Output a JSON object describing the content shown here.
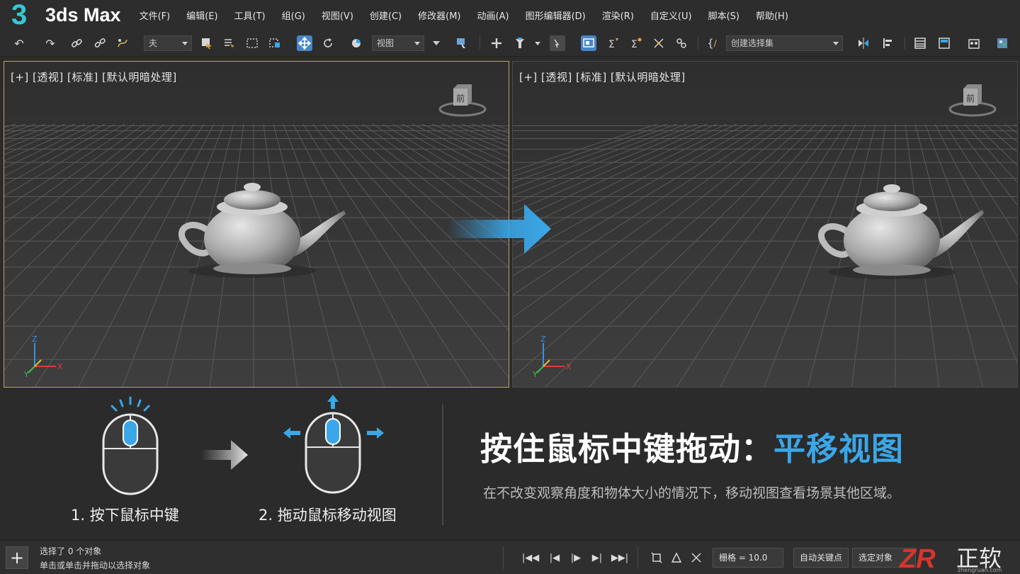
{
  "app": {
    "logo_number": "3",
    "name": "3ds Max"
  },
  "menu": [
    "文件(F)",
    "编辑(E)",
    "工具(T)",
    "组(G)",
    "视图(V)",
    "创建(C)",
    "修改器(M)",
    "动画(A)",
    "图形编辑器(D)",
    "渲染(R)",
    "自定义(U)",
    "脚本(S)",
    "帮助(H)"
  ],
  "toolbar": {
    "filter_dropdown": "夫",
    "reference_dropdown": "视图",
    "selection_set_dropdown": "创建选择集"
  },
  "viewports": {
    "left": {
      "label": "[+] [透视] [标准] [默认明暗处理]",
      "cube_face": "前"
    },
    "right": {
      "label": "[+] [透视] [标准] [默认明暗处理]",
      "cube_face": "前"
    },
    "axis": {
      "x": "X",
      "y": "Y",
      "z": "Z"
    }
  },
  "tutorial": {
    "step1": "1. 按下鼠标中键",
    "step2": "2. 拖动鼠标移动视图",
    "headline_main": "按住鼠标中键拖动：",
    "headline_accent": "平移视图",
    "description": "在不改变观察角度和物体大小的情况下，移动视图查看场景其他区域。"
  },
  "status": {
    "selection": "选择了 0 个对象",
    "hint": "单击或单击并拖动以选择对象",
    "grid": "栅格 = 10.0",
    "auto_key": "自动关键点",
    "selected_object": "选定对象"
  },
  "brand": {
    "logo": "ZR",
    "name": "正软",
    "site": "zhengruan.com"
  },
  "colors": {
    "accent": "#3aa7e8",
    "logo": "#33c9d6",
    "active_viewport_border": "#b8a462",
    "brand_red": "#d9342b"
  }
}
